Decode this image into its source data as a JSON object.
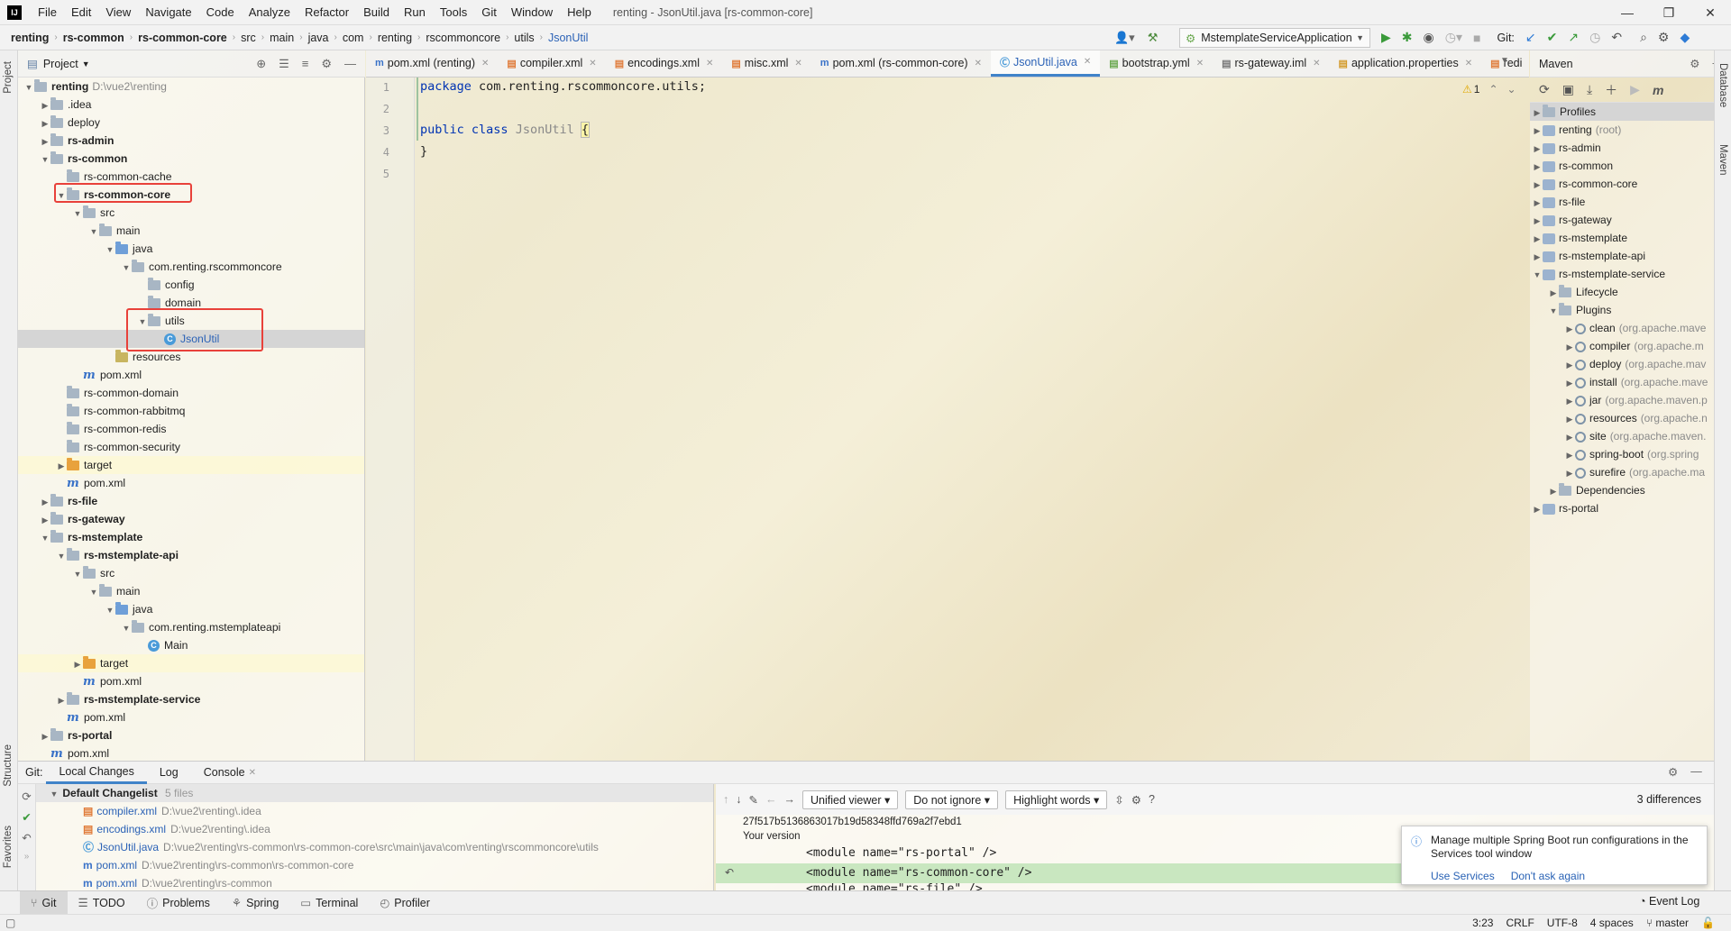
{
  "menu": {
    "items": [
      "File",
      "Edit",
      "View",
      "Navigate",
      "Code",
      "Analyze",
      "Refactor",
      "Build",
      "Run",
      "Tools",
      "Git",
      "Window",
      "Help"
    ],
    "window_title": "renting - JsonUtil.java [rs-common-core]"
  },
  "breadcrumb": [
    "renting",
    "rs-common",
    "rs-common-core",
    "src",
    "main",
    "java",
    "com",
    "renting",
    "rscommoncore",
    "utils",
    "JsonUtil"
  ],
  "run_config": "MstemplateServiceApplication",
  "git_label": "Git:",
  "project": {
    "title": "Project",
    "tree": [
      {
        "label": "renting",
        "path": "D:\\vue2\\renting",
        "depth": 0,
        "arrow": "▼",
        "icon": "fold",
        "bold": true
      },
      {
        "label": ".idea",
        "depth": 1,
        "arrow": "▶",
        "icon": "fold"
      },
      {
        "label": "deploy",
        "depth": 1,
        "arrow": "▶",
        "icon": "fold"
      },
      {
        "label": "rs-admin",
        "depth": 1,
        "arrow": "▶",
        "icon": "fold",
        "bold": true
      },
      {
        "label": "rs-common",
        "depth": 1,
        "arrow": "▼",
        "icon": "fold",
        "bold": true
      },
      {
        "label": "rs-common-cache",
        "depth": 2,
        "arrow": "",
        "icon": "fold"
      },
      {
        "label": "rs-common-core",
        "depth": 2,
        "arrow": "▼",
        "icon": "fold",
        "bold": true
      },
      {
        "label": "src",
        "depth": 3,
        "arrow": "▼",
        "icon": "fold"
      },
      {
        "label": "main",
        "depth": 4,
        "arrow": "▼",
        "icon": "fold"
      },
      {
        "label": "java",
        "depth": 5,
        "arrow": "▼",
        "icon": "src"
      },
      {
        "label": "com.renting.rscommoncore",
        "depth": 6,
        "arrow": "▼",
        "icon": "fold"
      },
      {
        "label": "config",
        "depth": 7,
        "arrow": "",
        "icon": "fold"
      },
      {
        "label": "domain",
        "depth": 7,
        "arrow": "",
        "icon": "fold"
      },
      {
        "label": "utils",
        "depth": 7,
        "arrow": "▼",
        "icon": "fold"
      },
      {
        "label": "JsonUtil",
        "depth": 8,
        "arrow": "",
        "icon": "class",
        "selected": true
      },
      {
        "label": "resources",
        "depth": 5,
        "arrow": "",
        "icon": "res"
      },
      {
        "label": "pom.xml",
        "depth": 3,
        "arrow": "",
        "icon": "mvn"
      },
      {
        "label": "rs-common-domain",
        "depth": 2,
        "arrow": "",
        "icon": "fold"
      },
      {
        "label": "rs-common-rabbitmq",
        "depth": 2,
        "arrow": "",
        "icon": "fold"
      },
      {
        "label": "rs-common-redis",
        "depth": 2,
        "arrow": "",
        "icon": "fold"
      },
      {
        "label": "rs-common-security",
        "depth": 2,
        "arrow": "",
        "icon": "fold"
      },
      {
        "label": "target",
        "depth": 2,
        "arrow": "▶",
        "icon": "org",
        "highlight": true
      },
      {
        "label": "pom.xml",
        "depth": 2,
        "arrow": "",
        "icon": "mvn"
      },
      {
        "label": "rs-file",
        "depth": 1,
        "arrow": "▶",
        "icon": "fold",
        "bold": true
      },
      {
        "label": "rs-gateway",
        "depth": 1,
        "arrow": "▶",
        "icon": "fold",
        "bold": true
      },
      {
        "label": "rs-mstemplate",
        "depth": 1,
        "arrow": "▼",
        "icon": "fold",
        "bold": true
      },
      {
        "label": "rs-mstemplate-api",
        "depth": 2,
        "arrow": "▼",
        "icon": "fold",
        "bold": true
      },
      {
        "label": "src",
        "depth": 3,
        "arrow": "▼",
        "icon": "fold"
      },
      {
        "label": "main",
        "depth": 4,
        "arrow": "▼",
        "icon": "fold"
      },
      {
        "label": "java",
        "depth": 5,
        "arrow": "▼",
        "icon": "src"
      },
      {
        "label": "com.renting.mstemplateapi",
        "depth": 6,
        "arrow": "▼",
        "icon": "fold"
      },
      {
        "label": "Main",
        "depth": 7,
        "arrow": "",
        "icon": "class"
      },
      {
        "label": "target",
        "depth": 3,
        "arrow": "▶",
        "icon": "org",
        "highlight": true
      },
      {
        "label": "pom.xml",
        "depth": 3,
        "arrow": "",
        "icon": "mvn"
      },
      {
        "label": "rs-mstemplate-service",
        "depth": 2,
        "arrow": "▶",
        "icon": "fold",
        "bold": true
      },
      {
        "label": "pom.xml",
        "depth": 2,
        "arrow": "",
        "icon": "mvn"
      },
      {
        "label": "rs-portal",
        "depth": 1,
        "arrow": "▶",
        "icon": "fold",
        "bold": true
      },
      {
        "label": "pom.xml",
        "depth": 1,
        "arrow": "",
        "icon": "mvn"
      }
    ]
  },
  "tabs": [
    {
      "label": "pom.xml (renting)",
      "icon": "m"
    },
    {
      "label": "compiler.xml",
      "icon": "x"
    },
    {
      "label": "encodings.xml",
      "icon": "x"
    },
    {
      "label": "misc.xml",
      "icon": "x"
    },
    {
      "label": "pom.xml (rs-common-core)",
      "icon": "m"
    },
    {
      "label": "JsonUtil.java",
      "icon": "c",
      "active": true
    },
    {
      "label": "bootstrap.yml",
      "icon": "y"
    },
    {
      "label": "rs-gateway.iml",
      "icon": "i"
    },
    {
      "label": "application.properties",
      "icon": "p"
    },
    {
      "label": "redi",
      "icon": "x"
    }
  ],
  "editor": {
    "lines": [
      "1",
      "2",
      "3",
      "4",
      "5"
    ],
    "code": {
      "l1_kw": "package",
      "l1_rest": " com.renting.rscommoncore.utils;",
      "l3_kw1": "public",
      "l3_kw2": "class",
      "l3_name": "JsonUtil",
      "l3_brace": "{",
      "l4": "}"
    },
    "warning_count": "1"
  },
  "maven": {
    "title": "Maven",
    "tree": [
      {
        "label": "Profiles",
        "depth": 0,
        "arrow": "▶",
        "icon": "fold",
        "sel": true
      },
      {
        "label": "renting",
        "suffix": "(root)",
        "depth": 0,
        "arrow": "▶",
        "icon": "mod"
      },
      {
        "label": "rs-admin",
        "depth": 0,
        "arrow": "▶",
        "icon": "mod"
      },
      {
        "label": "rs-common",
        "depth": 0,
        "arrow": "▶",
        "icon": "mod"
      },
      {
        "label": "rs-common-core",
        "depth": 0,
        "arrow": "▶",
        "icon": "mod"
      },
      {
        "label": "rs-file",
        "depth": 0,
        "arrow": "▶",
        "icon": "mod"
      },
      {
        "label": "rs-gateway",
        "depth": 0,
        "arrow": "▶",
        "icon": "mod"
      },
      {
        "label": "rs-mstemplate",
        "depth": 0,
        "arrow": "▶",
        "icon": "mod"
      },
      {
        "label": "rs-mstemplate-api",
        "depth": 0,
        "arrow": "▶",
        "icon": "mod"
      },
      {
        "label": "rs-mstemplate-service",
        "depth": 0,
        "arrow": "▼",
        "icon": "mod"
      },
      {
        "label": "Lifecycle",
        "depth": 1,
        "arrow": "▶",
        "icon": "fold"
      },
      {
        "label": "Plugins",
        "depth": 1,
        "arrow": "▼",
        "icon": "fold"
      },
      {
        "label": "clean",
        "suffix": "(org.apache.mave",
        "depth": 2,
        "arrow": "▶",
        "icon": "gear"
      },
      {
        "label": "compiler",
        "suffix": "(org.apache.m",
        "depth": 2,
        "arrow": "▶",
        "icon": "gear"
      },
      {
        "label": "deploy",
        "suffix": "(org.apache.mav",
        "depth": 2,
        "arrow": "▶",
        "icon": "gear"
      },
      {
        "label": "install",
        "suffix": "(org.apache.mave",
        "depth": 2,
        "arrow": "▶",
        "icon": "gear"
      },
      {
        "label": "jar",
        "suffix": "(org.apache.maven.p",
        "depth": 2,
        "arrow": "▶",
        "icon": "gear"
      },
      {
        "label": "resources",
        "suffix": "(org.apache.n",
        "depth": 2,
        "arrow": "▶",
        "icon": "gear"
      },
      {
        "label": "site",
        "suffix": "(org.apache.maven.",
        "depth": 2,
        "arrow": "▶",
        "icon": "gear"
      },
      {
        "label": "spring-boot",
        "suffix": "(org.spring",
        "depth": 2,
        "arrow": "▶",
        "icon": "gear"
      },
      {
        "label": "surefire",
        "suffix": "(org.apache.ma",
        "depth": 2,
        "arrow": "▶",
        "icon": "gear"
      },
      {
        "label": "Dependencies",
        "depth": 1,
        "arrow": "▶",
        "icon": "fold"
      },
      {
        "label": "rs-portal",
        "depth": 0,
        "arrow": "▶",
        "icon": "mod"
      }
    ]
  },
  "side_labels": {
    "project": "Project",
    "structure": "Structure",
    "favorites": "Favorites",
    "database": "Database",
    "maven": "Maven"
  },
  "bottom": {
    "tabs": [
      "Git:",
      "Local Changes",
      "Log",
      "Console"
    ],
    "changelist": {
      "name": "Default Changelist",
      "count": "5 files"
    },
    "changes": [
      {
        "file": "compiler.xml",
        "path": "D:\\vue2\\renting\\.idea"
      },
      {
        "file": "encodings.xml",
        "path": "D:\\vue2\\renting\\.idea"
      },
      {
        "file": "JsonUtil.java",
        "path": "D:\\vue2\\renting\\rs-common\\rs-common-core\\src\\main\\java\\com\\renting\\rscommoncore\\utils"
      },
      {
        "file": "pom.xml",
        "path": "D:\\vue2\\renting\\rs-common\\rs-common-core"
      },
      {
        "file": "pom.xml",
        "path": "D:\\vue2\\renting\\rs-common"
      }
    ],
    "diff": {
      "viewer": "Unified viewer",
      "ignore": "Do not ignore",
      "highlight": "Highlight words",
      "differences": "3 differences",
      "hash": "27f517b5136863017b19d58348ffd769a2f7ebd1",
      "version": "Your version",
      "line1": "<module name=\"rs-portal\" />",
      "line2": "<module name=\"rs-common-core\" />",
      "line3": "<module name=\"rs-file\" />"
    }
  },
  "notification": {
    "text": "Manage multiple Spring Boot run configurations in the Services tool window",
    "action1": "Use Services",
    "action2": "Don't ask again"
  },
  "toolwindows": [
    "Git",
    "TODO",
    "Problems",
    "Spring",
    "Terminal",
    "Profiler"
  ],
  "event_log": "Event Log",
  "status": {
    "position": "3:23",
    "line_sep": "CRLF",
    "encoding": "UTF-8",
    "indent": "4 spaces",
    "branch": "master"
  },
  "colors": {
    "accent": "#4083c9",
    "highlight_box": "#e8413a",
    "diff_added": "#c9e7c0"
  }
}
